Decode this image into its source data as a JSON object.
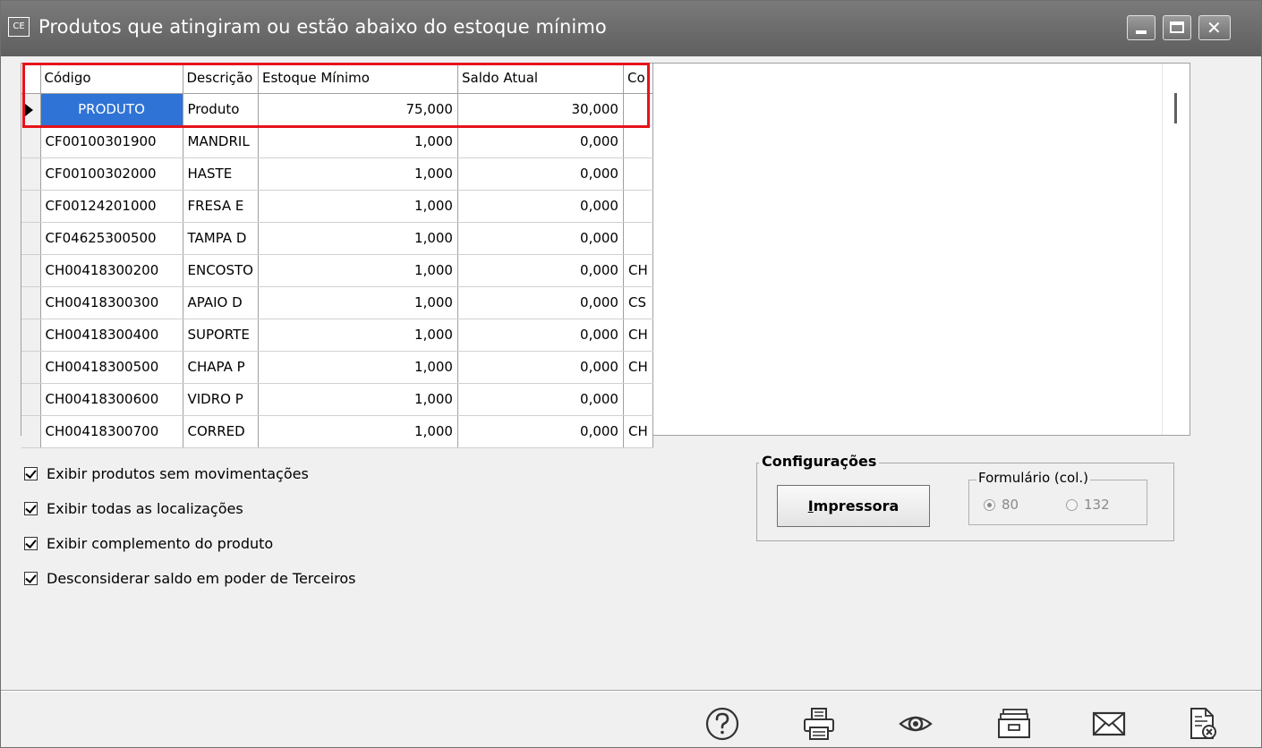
{
  "window": {
    "app_icon": "CE",
    "title": "Produtos que atingiram ou estão abaixo do estoque mínimo",
    "controls": [
      "minimize-icon",
      "maximize-icon",
      "close-icon"
    ]
  },
  "grid": {
    "columns": [
      "Código",
      "Descrição",
      "Estoque Mínimo",
      "Saldo Atual",
      "Co"
    ],
    "rows": [
      {
        "codigo": "PRODUTO",
        "descricao": "Produto",
        "estoque_minimo": "75,000",
        "saldo_atual": "30,000",
        "co": "",
        "selected": true
      },
      {
        "codigo": "CF00100301900",
        "descricao": "MANDRIL",
        "estoque_minimo": "1,000",
        "saldo_atual": "0,000",
        "co": ""
      },
      {
        "codigo": "CF00100302000",
        "descricao": "HASTE",
        "estoque_minimo": "1,000",
        "saldo_atual": "0,000",
        "co": ""
      },
      {
        "codigo": "CF00124201000",
        "descricao": "FRESA E",
        "estoque_minimo": "1,000",
        "saldo_atual": "0,000",
        "co": ""
      },
      {
        "codigo": "CF04625300500",
        "descricao": "TAMPA D",
        "estoque_minimo": "1,000",
        "saldo_atual": "0,000",
        "co": ""
      },
      {
        "codigo": "CH00418300200",
        "descricao": "ENCOSTO",
        "estoque_minimo": "1,000",
        "saldo_atual": "0,000",
        "co": "CH"
      },
      {
        "codigo": "CH00418300300",
        "descricao": "APAIO D",
        "estoque_minimo": "1,000",
        "saldo_atual": "0,000",
        "co": "CS"
      },
      {
        "codigo": "CH00418300400",
        "descricao": "SUPORTE",
        "estoque_minimo": "1,000",
        "saldo_atual": "0,000",
        "co": "CH"
      },
      {
        "codigo": "CH00418300500",
        "descricao": "CHAPA P",
        "estoque_minimo": "1,000",
        "saldo_atual": "0,000",
        "co": "CH"
      },
      {
        "codigo": "CH00418300600",
        "descricao": "VIDRO P",
        "estoque_minimo": "1,000",
        "saldo_atual": "0,000",
        "co": ""
      },
      {
        "codigo": "CH00418300700",
        "descricao": "CORRED",
        "estoque_minimo": "1,000",
        "saldo_atual": "0,000",
        "co": "CH"
      }
    ]
  },
  "options": [
    {
      "label": "Exibir produtos sem movimentações",
      "checked": true
    },
    {
      "label": "Exibir todas as localizações",
      "checked": true
    },
    {
      "label": "Exibir complemento do produto",
      "checked": true
    },
    {
      "label": "Desconsiderar saldo em poder de Terceiros",
      "checked": true
    }
  ],
  "configuracoes": {
    "title": "Configurações",
    "printer_button": {
      "accel": "I",
      "rest": "mpressora"
    },
    "formulario": {
      "title": "Formulário (col.)",
      "options": [
        {
          "label": "80",
          "selected": true
        },
        {
          "label": "132",
          "selected": false
        }
      ]
    }
  },
  "toolbar": [
    "help-icon",
    "print-icon",
    "preview-icon",
    "folder-icon",
    "email-icon",
    "close-document-icon"
  ],
  "colors": {
    "highlight_border": "#e5131b",
    "selection": "#2f73d6",
    "titlebar": "#6a6a6a"
  }
}
